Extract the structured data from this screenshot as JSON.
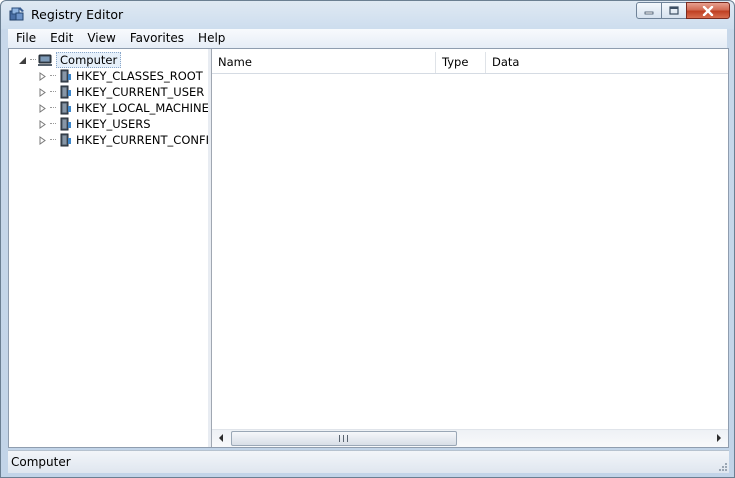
{
  "window": {
    "title": "Registry Editor",
    "icon": "regedit-icon"
  },
  "menu": {
    "items": [
      "File",
      "Edit",
      "View",
      "Favorites",
      "Help"
    ]
  },
  "tree": {
    "root": {
      "label": "Computer",
      "icon": "computer-icon"
    },
    "keys": [
      {
        "label": "HKEY_CLASSES_ROOT",
        "icon": "folder-key-icon"
      },
      {
        "label": "HKEY_CURRENT_USER",
        "icon": "folder-key-icon"
      },
      {
        "label": "HKEY_LOCAL_MACHINE",
        "icon": "folder-key-icon"
      },
      {
        "label": "HKEY_USERS",
        "icon": "folder-key-icon"
      },
      {
        "label": "HKEY_CURRENT_CONFIG",
        "icon": "folder-key-icon"
      }
    ]
  },
  "list": {
    "columns": [
      "Name",
      "Type",
      "Data"
    ]
  },
  "status": {
    "text": "Computer"
  },
  "colors": {
    "frame": "#c2d4e8",
    "close_button": "#c04023",
    "selection": "#e6f0fa"
  }
}
